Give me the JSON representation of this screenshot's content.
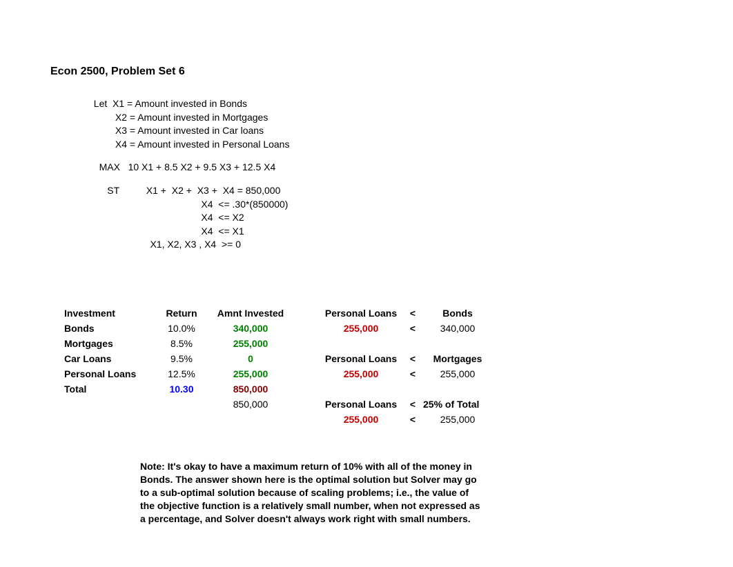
{
  "title": "Econ 2500, Problem Set 6",
  "defs": {
    "let": "Let",
    "lines": [
      "X1 = Amount invested in Bonds",
      "X2 = Amount invested in Mortgages",
      "X3 = Amount invested in Car loans",
      "X4 = Amount invested in Personal Loans"
    ],
    "max_label": "MAX",
    "max_expr": "10 X1 + 8.5 X2 + 9.5 X3 + 12.5 X4",
    "st_label": "ST",
    "st_lines": [
      "X1 +  X2 +  X3 +  X4 = 850,000",
      "X4  <= .30*(850000)",
      "X4  <= X2",
      "X4  <= X1",
      "X1, X2, X3 , X4  >= 0"
    ]
  },
  "table": {
    "headers": {
      "investment": "Investment",
      "return": "Return",
      "amnt": "Amnt Invested",
      "personal": "Personal Loans",
      "lt": "<",
      "bonds": "Bonds",
      "mortgages": "Mortgages",
      "pct_total": "25% of Total"
    },
    "rows": [
      {
        "name": "Bonds",
        "return": "10.0%",
        "amnt": "340,000"
      },
      {
        "name": "Mortgages",
        "return": "8.5%",
        "amnt": "255,000"
      },
      {
        "name": "Car Loans",
        "return": "9.5%",
        "amnt": "0"
      },
      {
        "name": "Personal Loans",
        "return": "12.5%",
        "amnt": "255,000"
      },
      {
        "name": "Total",
        "return": "10.30",
        "amnt": "850,000"
      }
    ],
    "sum_amnt": "850,000",
    "constraints": {
      "pl": "255,000",
      "bonds_limit": "340,000",
      "mort_limit": "255,000",
      "tot_limit": "255,000"
    }
  },
  "note": "Note: It's okay to have a maximum return of 10% with all of the money in Bonds. The answer shown here is the optimal solution but Solver may go to a sub-optimal solution because of scaling problems; i.e., the value of the objective function is a relatively small number, when not expressed as a percentage, and Solver doesn't always work right with small numbers."
}
